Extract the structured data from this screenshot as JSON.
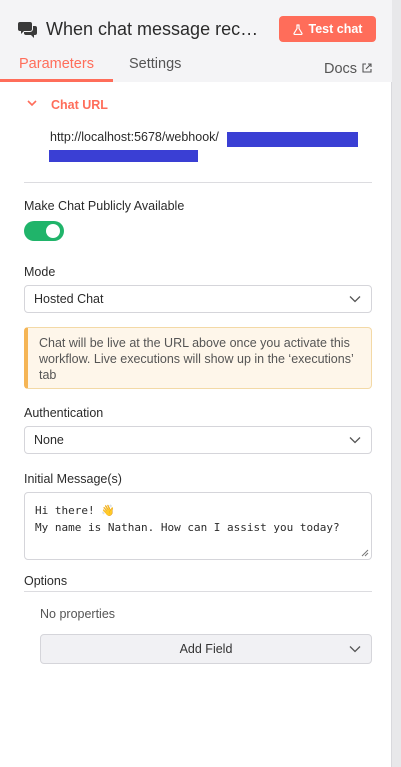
{
  "header": {
    "title": "When chat message recei...",
    "title_icon": "chat-bubbles-icon",
    "test_button": "Test chat",
    "test_button_icon": "flask-icon",
    "tabs": [
      {
        "label": "Parameters",
        "active": true
      },
      {
        "label": "Settings",
        "active": false
      },
      {
        "label": "Docs",
        "icon": "external-link-icon"
      }
    ]
  },
  "chat_url": {
    "section_label": "Chat URL",
    "url": "http://localhost:5678/webhook/",
    "redaction_color": "#3a3fd4"
  },
  "public": {
    "label": "Make Chat Publicly Available",
    "enabled": true,
    "color": "#20b46a"
  },
  "mode": {
    "label": "Mode",
    "value": "Hosted Chat"
  },
  "notice": {
    "text": "Chat will be live at the URL above once you activate this workflow. Live executions will show up in the ‘executions’ tab"
  },
  "authentication": {
    "label": "Authentication",
    "value": "None"
  },
  "initial_messages": {
    "label": "Initial Message(s)",
    "line1": "Hi there! 👋",
    "line2": "My name is Nathan. How can I assist you today?"
  },
  "options": {
    "label": "Options",
    "empty_text": "No properties",
    "add_field": "Add Field"
  },
  "colors": {
    "accent": "#ff6d5a",
    "background": "#f4f4f6"
  }
}
